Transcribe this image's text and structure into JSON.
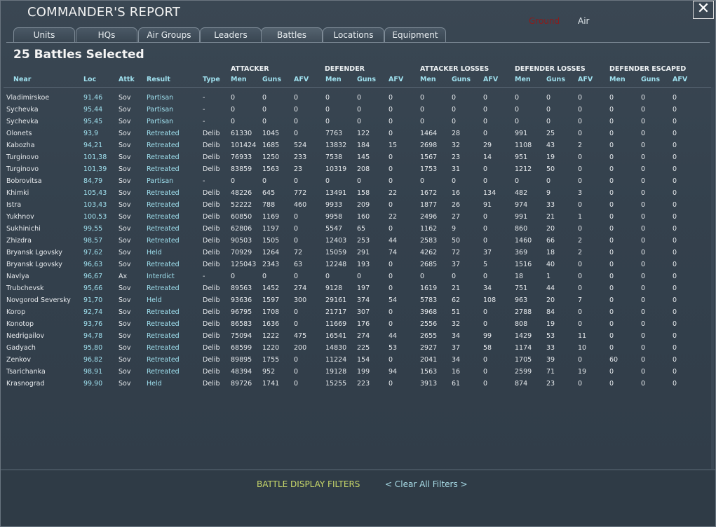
{
  "window": {
    "title": "COMMANDER'S REPORT",
    "close_glyph": "✕",
    "mode_ground": "Ground",
    "mode_air": "Air",
    "colors": {
      "ground_active": "#8a1c1c",
      "header_cyan": "#9fe0ee",
      "filter_yellow": "#c9d86a"
    }
  },
  "tabs": [
    {
      "label": "Units"
    },
    {
      "label": "HQs"
    },
    {
      "label": "Air Groups"
    },
    {
      "label": "Leaders"
    },
    {
      "label": "Battles",
      "active": true
    },
    {
      "label": "Locations"
    },
    {
      "label": "Equipment"
    }
  ],
  "heading": "25 Battles Selected",
  "column_groups": [
    "ATTACKER",
    "DEFENDER",
    "ATTACKER LOSSES",
    "DEFENDER LOSSES",
    "DEFENDER ESCAPED"
  ],
  "columns": [
    "Near",
    "Loc",
    "Attk",
    "Result",
    "Type",
    "Men",
    "Guns",
    "AFV",
    "Men",
    "Guns",
    "AFV",
    "Men",
    "Guns",
    "AFV",
    "Men",
    "Guns",
    "AFV",
    "Men",
    "Guns",
    "AFV"
  ],
  "battles": [
    [
      "Vladimirskoe",
      "91,46",
      "Sov",
      "Partisan",
      "-",
      "0",
      "0",
      "0",
      "0",
      "0",
      "0",
      "0",
      "0",
      "0",
      "0",
      "0",
      "0",
      "0",
      "0",
      "0"
    ],
    [
      "Sychevka",
      "95,44",
      "Sov",
      "Partisan",
      "-",
      "0",
      "0",
      "0",
      "0",
      "0",
      "0",
      "0",
      "0",
      "0",
      "0",
      "0",
      "0",
      "0",
      "0",
      "0"
    ],
    [
      "Sychevka",
      "95,45",
      "Sov",
      "Partisan",
      "-",
      "0",
      "0",
      "0",
      "0",
      "0",
      "0",
      "0",
      "0",
      "0",
      "0",
      "0",
      "0",
      "0",
      "0",
      "0"
    ],
    [
      "Olonets",
      "93,9",
      "Sov",
      "Retreated",
      "Delib",
      "61330",
      "1045",
      "0",
      "7763",
      "122",
      "0",
      "1464",
      "28",
      "0",
      "991",
      "25",
      "0",
      "0",
      "0",
      "0"
    ],
    [
      "Kabozha",
      "94,21",
      "Sov",
      "Retreated",
      "Delib",
      "101424",
      "1685",
      "524",
      "13832",
      "184",
      "15",
      "2698",
      "32",
      "29",
      "1108",
      "43",
      "2",
      "0",
      "0",
      "0"
    ],
    [
      "Turginovo",
      "101,38",
      "Sov",
      "Retreated",
      "Delib",
      "76933",
      "1250",
      "233",
      "7538",
      "145",
      "0",
      "1567",
      "23",
      "14",
      "951",
      "19",
      "0",
      "0",
      "0",
      "0"
    ],
    [
      "Turginovo",
      "101,39",
      "Sov",
      "Retreated",
      "Delib",
      "83859",
      "1563",
      "23",
      "10319",
      "208",
      "0",
      "1753",
      "31",
      "0",
      "1212",
      "50",
      "0",
      "0",
      "0",
      "0"
    ],
    [
      "Bobrovitsa",
      "84,79",
      "Sov",
      "Partisan",
      "-",
      "0",
      "0",
      "0",
      "0",
      "0",
      "0",
      "0",
      "0",
      "0",
      "0",
      "0",
      "0",
      "0",
      "0",
      "0"
    ],
    [
      "Khimki",
      "105,43",
      "Sov",
      "Retreated",
      "Delib",
      "48226",
      "645",
      "772",
      "13491",
      "158",
      "22",
      "1672",
      "16",
      "134",
      "482",
      "9",
      "3",
      "0",
      "0",
      "0"
    ],
    [
      "Istra",
      "103,43",
      "Sov",
      "Retreated",
      "Delib",
      "52222",
      "788",
      "460",
      "9933",
      "209",
      "0",
      "1877",
      "26",
      "91",
      "974",
      "33",
      "0",
      "0",
      "0",
      "0"
    ],
    [
      "Yukhnov",
      "100,53",
      "Sov",
      "Retreated",
      "Delib",
      "60850",
      "1169",
      "0",
      "9958",
      "160",
      "22",
      "2496",
      "27",
      "0",
      "991",
      "21",
      "1",
      "0",
      "0",
      "0"
    ],
    [
      "Sukhinichi",
      "99,55",
      "Sov",
      "Retreated",
      "Delib",
      "62806",
      "1197",
      "0",
      "5547",
      "65",
      "0",
      "1162",
      "9",
      "0",
      "860",
      "20",
      "0",
      "0",
      "0",
      "0"
    ],
    [
      "Zhizdra",
      "98,57",
      "Sov",
      "Retreated",
      "Delib",
      "90503",
      "1505",
      "0",
      "12403",
      "253",
      "44",
      "2583",
      "50",
      "0",
      "1460",
      "66",
      "2",
      "0",
      "0",
      "0"
    ],
    [
      "Bryansk Lgovsky",
      "97,62",
      "Sov",
      "Held",
      "Delib",
      "70929",
      "1264",
      "72",
      "15059",
      "291",
      "74",
      "4262",
      "72",
      "37",
      "369",
      "18",
      "2",
      "0",
      "0",
      "0"
    ],
    [
      "Bryansk Lgovsky",
      "96,63",
      "Sov",
      "Retreated",
      "Delib",
      "125043",
      "2343",
      "63",
      "12248",
      "193",
      "0",
      "2685",
      "37",
      "5",
      "1516",
      "40",
      "0",
      "0",
      "0",
      "0"
    ],
    [
      "Navlya",
      "96,67",
      "Ax",
      "Interdict",
      "-",
      "0",
      "0",
      "0",
      "0",
      "0",
      "0",
      "0",
      "0",
      "0",
      "18",
      "1",
      "0",
      "0",
      "0",
      "0"
    ],
    [
      "Trubchevsk",
      "95,66",
      "Sov",
      "Retreated",
      "Delib",
      "89563",
      "1452",
      "274",
      "9128",
      "197",
      "0",
      "1619",
      "21",
      "34",
      "751",
      "44",
      "0",
      "0",
      "0",
      "0"
    ],
    [
      "Novgorod Seversky",
      "91,70",
      "Sov",
      "Held",
      "Delib",
      "93636",
      "1597",
      "300",
      "29161",
      "374",
      "54",
      "5783",
      "62",
      "108",
      "963",
      "20",
      "7",
      "0",
      "0",
      "0"
    ],
    [
      "Korop",
      "92,74",
      "Sov",
      "Retreated",
      "Delib",
      "96795",
      "1708",
      "0",
      "21717",
      "307",
      "0",
      "3968",
      "51",
      "0",
      "2788",
      "84",
      "0",
      "0",
      "0",
      "0"
    ],
    [
      "Konotop",
      "93,76",
      "Sov",
      "Retreated",
      "Delib",
      "86583",
      "1636",
      "0",
      "11669",
      "176",
      "0",
      "2556",
      "32",
      "0",
      "808",
      "19",
      "0",
      "0",
      "0",
      "0"
    ],
    [
      "Nedrigailov",
      "94,78",
      "Sov",
      "Retreated",
      "Delib",
      "75094",
      "1222",
      "475",
      "16541",
      "274",
      "44",
      "2655",
      "34",
      "99",
      "1429",
      "53",
      "11",
      "0",
      "0",
      "0"
    ],
    [
      "Gadyach",
      "95,80",
      "Sov",
      "Retreated",
      "Delib",
      "68599",
      "1220",
      "200",
      "14830",
      "225",
      "53",
      "2927",
      "37",
      "58",
      "1174",
      "33",
      "10",
      "0",
      "0",
      "0"
    ],
    [
      "Zenkov",
      "96,82",
      "Sov",
      "Retreated",
      "Delib",
      "89895",
      "1755",
      "0",
      "11224",
      "154",
      "0",
      "2041",
      "34",
      "0",
      "1705",
      "39",
      "0",
      "60",
      "0",
      "0"
    ],
    [
      "Tsarichanka",
      "98,91",
      "Sov",
      "Retreated",
      "Delib",
      "48394",
      "952",
      "0",
      "19128",
      "199",
      "94",
      "1563",
      "16",
      "0",
      "2599",
      "71",
      "19",
      "0",
      "0",
      "0"
    ],
    [
      "Krasnograd",
      "99,90",
      "Sov",
      "Held",
      "Delib",
      "89726",
      "1741",
      "0",
      "15255",
      "223",
      "0",
      "3913",
      "61",
      "0",
      "874",
      "23",
      "0",
      "0",
      "0",
      "0"
    ]
  ],
  "footer": {
    "filters_label": "BATTLE DISPLAY FILTERS",
    "clear_filters": "< Clear All Filters >"
  }
}
